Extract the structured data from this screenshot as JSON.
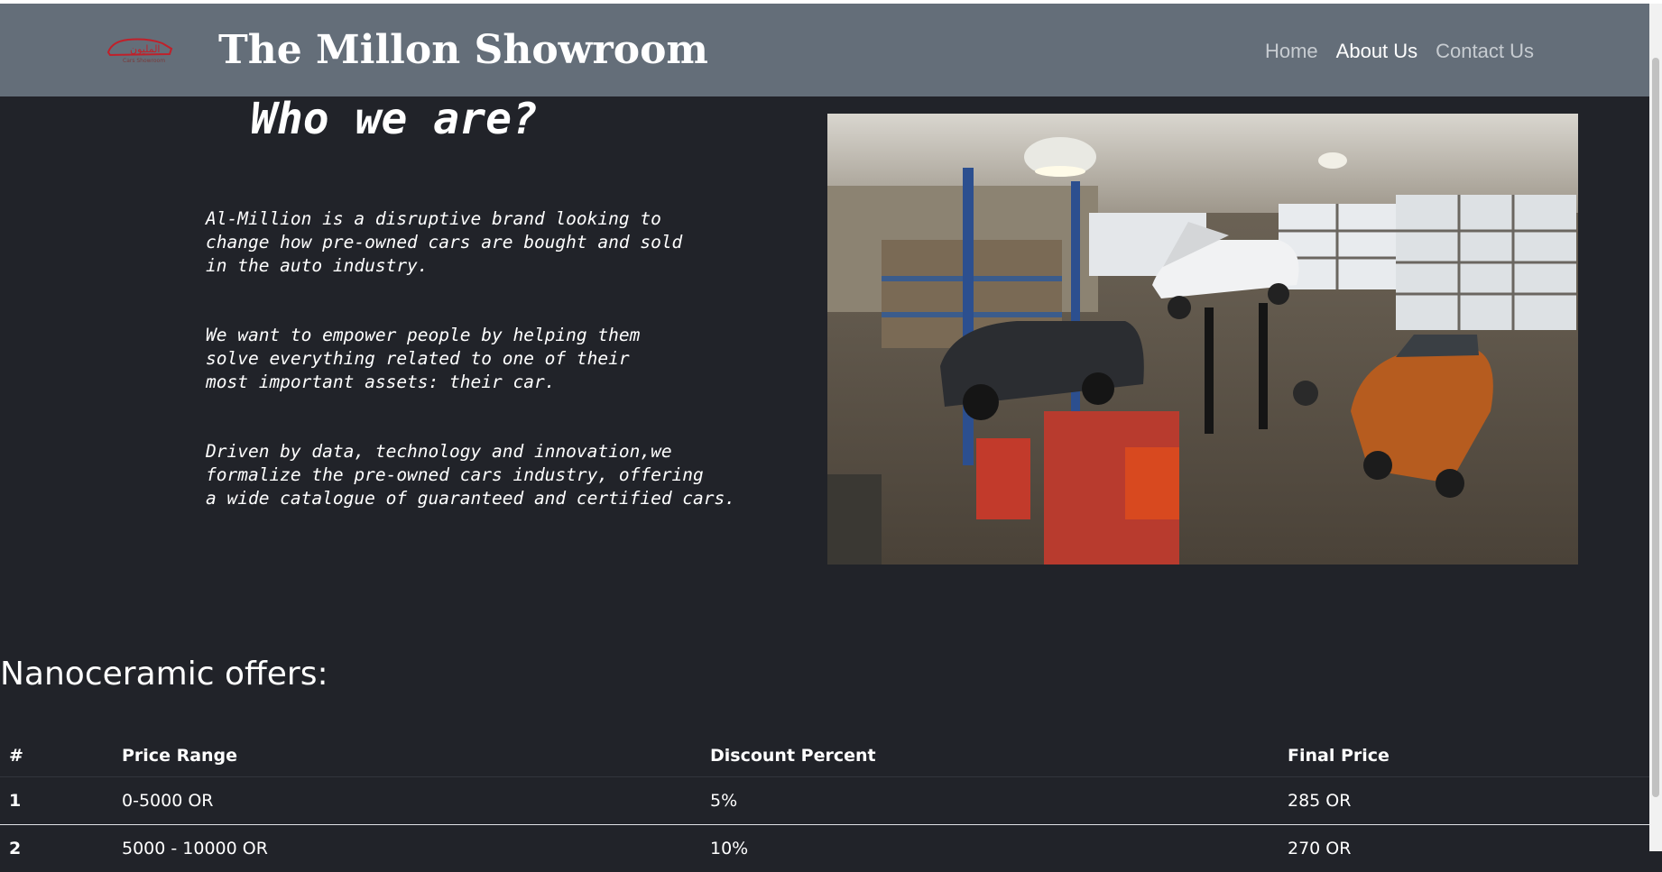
{
  "navbar": {
    "brand": "The Millon Showroom",
    "logo_text": "المليون",
    "logo_subtext": "Cars Showroom",
    "links": [
      "Home",
      "About Us",
      "Contact Us"
    ],
    "active": "About Us"
  },
  "about": {
    "heading": "Who we are?",
    "paragraphs": [
      "Al-Million is a disruptive brand looking to\nchange how pre-owned cars are bought and sold\nin the auto industry.",
      "We want to empower people by helping them\nsolve everything related to one of their\nmost important assets: their car.",
      "Driven by data, technology and innovation,we\nformalize the pre-owned cars industry, offering\na wide catalogue of guaranteed and certified cars."
    ],
    "photo_icon": "garage-photo"
  },
  "offers": {
    "title": "Nanoceramic offers:",
    "columns": [
      "#",
      "Price Range",
      "Discount Percent",
      "Final Price"
    ],
    "rows": [
      [
        "1",
        "0-5000 OR",
        "5%",
        "285 OR"
      ],
      [
        "2",
        "5000 - 10000 OR",
        "10%",
        "270 OR"
      ]
    ]
  },
  "colors": {
    "navbar": "#646e79",
    "background": "#212329",
    "logo_red": "#c0202a"
  }
}
